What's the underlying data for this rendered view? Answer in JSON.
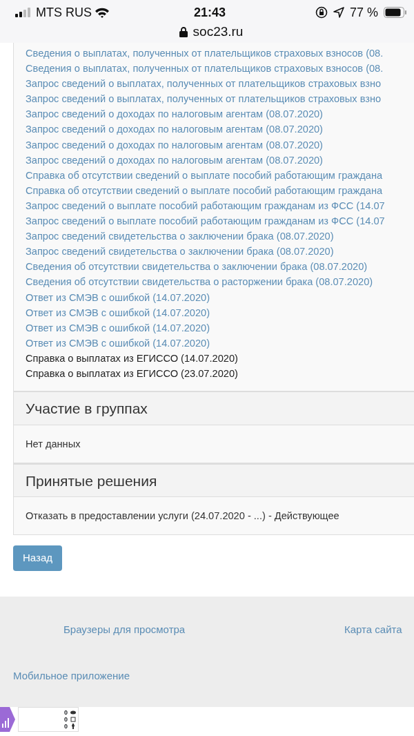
{
  "status_bar": {
    "carrier": "MTS RUS",
    "time": "21:43",
    "battery": "77 %"
  },
  "address_bar": {
    "url": "soc23.ru"
  },
  "documents": [
    {
      "kind": "link",
      "text": "Сведения о выплатах, полученных от плательщиков страховых взносов (08."
    },
    {
      "kind": "link",
      "text": "Сведения о выплатах, полученных от плательщиков страховых взносов (08."
    },
    {
      "kind": "link",
      "text": "Запрос сведений о выплатах, полученных от плательщиков страховых взно"
    },
    {
      "kind": "link",
      "text": "Запрос сведений о выплатах, полученных от плательщиков страховых взно"
    },
    {
      "kind": "link",
      "text": "Запрос сведений о доходах по налоговым агентам (08.07.2020)"
    },
    {
      "kind": "link",
      "text": "Запрос сведений о доходах по налоговым агентам (08.07.2020)"
    },
    {
      "kind": "link",
      "text": "Запрос сведений о доходах по налоговым агентам (08.07.2020)"
    },
    {
      "kind": "link",
      "text": "Запрос сведений о доходах по налоговым агентам (08.07.2020)"
    },
    {
      "kind": "link",
      "text": "Справка об отсутствии сведений о выплате пособий работающим граждана"
    },
    {
      "kind": "link",
      "text": "Справка об отсутствии сведений о выплате пособий работающим граждана"
    },
    {
      "kind": "link",
      "text": "Запрос сведений о выплате пособий работающим гражданам из ФСС (14.07"
    },
    {
      "kind": "link",
      "text": "Запрос сведений о выплате пособий работающим гражданам из ФСС (14.07"
    },
    {
      "kind": "link",
      "text": "Запрос сведений свидетельства о заключении брака (08.07.2020)"
    },
    {
      "kind": "link",
      "text": "Запрос сведений свидетельства о заключении брака (08.07.2020)"
    },
    {
      "kind": "link",
      "text": "Сведения об отсутствии свидетельства о заключении брака (08.07.2020)"
    },
    {
      "kind": "link",
      "text": "Сведения об отсутствии свидетельства о расторжении брака (08.07.2020)"
    },
    {
      "kind": "link",
      "text": "Ответ из СМЭВ с ошибкой (14.07.2020)"
    },
    {
      "kind": "link",
      "text": "Ответ из СМЭВ с ошибкой (14.07.2020)"
    },
    {
      "kind": "link",
      "text": "Ответ из СМЭВ с ошибкой (14.07.2020)"
    },
    {
      "kind": "link",
      "text": "Ответ из СМЭВ с ошибкой (14.07.2020)"
    },
    {
      "kind": "text",
      "text": "Справка о выплатах из ЕГИССО (14.07.2020)"
    },
    {
      "kind": "text",
      "text": "Справка о выплатах из ЕГИССО (23.07.2020)"
    }
  ],
  "sections": [
    {
      "title": "Участие в группах",
      "body": "Нет данных"
    },
    {
      "title": "Принятые решения",
      "body": "Отказать в предоставлении услуги (24.07.2020 - ...) - Действующее"
    }
  ],
  "back_button": "Назад",
  "footer": {
    "links": [
      "Браузеры для просмотра",
      "Карта сайта",
      "Мобильное приложение"
    ]
  },
  "counter": {
    "values": [
      "0",
      "0",
      "0"
    ]
  }
}
